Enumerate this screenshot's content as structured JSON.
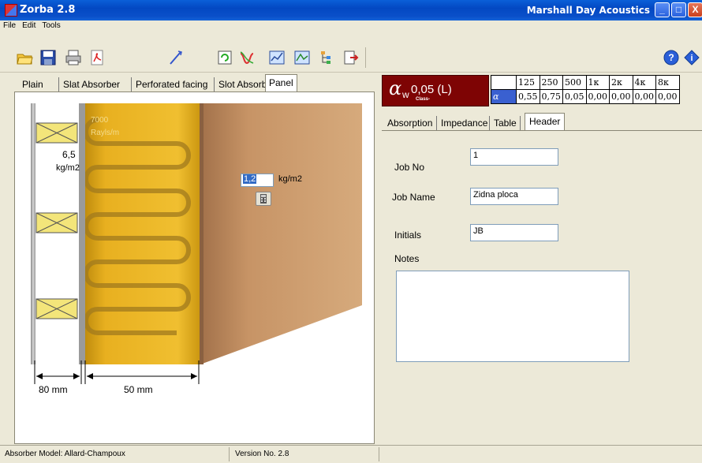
{
  "window": {
    "title": "Zorba  2.8",
    "company": "Marshall Day Acoustics",
    "buttons": {
      "minimize": "_",
      "maximize": "□",
      "close": "X"
    }
  },
  "menu": [
    "File",
    "Edit",
    "Tools"
  ],
  "toolbar": {
    "icons": [
      "open-folder-icon",
      "save-icon",
      "print-icon",
      "pdf-icon",
      "wand-icon",
      "refresh-icon",
      "curve-icon",
      "graph-icon",
      "graph-alt-icon",
      "tree-icon",
      "export-icon",
      "help-icon",
      "info-icon"
    ]
  },
  "left_tabs": [
    "Plain",
    "Slat Absorber",
    "Perforated facing",
    "Slot Absorber",
    "Panel"
  ],
  "drawing": {
    "panel_mass": "6,5",
    "panel_mass_unit": "kg/m2",
    "flow_resistivity": "7000",
    "flow_resistivity_unit": "Rayls/m",
    "mass_input_value": "1,2",
    "mass_input_unit": "kg/m2",
    "gap_dimension": "80 mm",
    "absorber_dimension": "50 mm",
    "colors": {
      "insulation": "#e8b020",
      "wall": "#c79466",
      "stud": "#f0e07a"
    }
  },
  "rating": {
    "symbol": "α",
    "subscript": "w",
    "value": "0,05 (L)",
    "class_label": "Class-"
  },
  "freq_table": {
    "row_label": "α",
    "headers": [
      "125",
      "250",
      "500",
      "1κ",
      "2κ",
      "4κ",
      "8κ"
    ],
    "values": [
      "0,55",
      "0,75",
      "0,05",
      "0,00",
      "0,00",
      "0,00",
      "0,00"
    ]
  },
  "right_tabs": [
    "Absorption",
    "Impedance",
    "Table",
    "Header"
  ],
  "header_form": {
    "job_no_label": "Job No",
    "job_no_value": "1",
    "job_name_label": "Job Name",
    "job_name_value": "Zidna ploca",
    "initials_label": "Initials",
    "initials_value": "JB",
    "notes_label": "Notes",
    "notes_value": ""
  },
  "status": {
    "model": "Absorber Model:  Allard-Champoux",
    "version": "Version No. 2.8"
  }
}
